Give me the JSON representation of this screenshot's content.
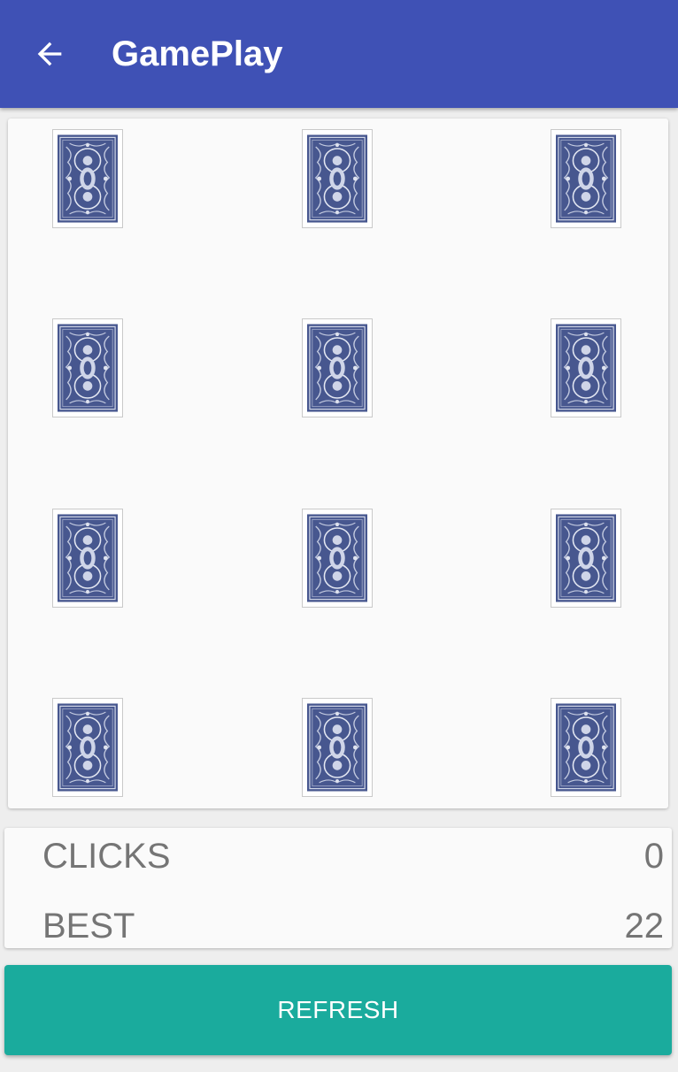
{
  "app_bar": {
    "title": "GamePlay",
    "back_icon": "arrow-back-icon",
    "background_color": "#3f51b5"
  },
  "board": {
    "columns": 3,
    "rows": 4,
    "card_back_color": "#47578f",
    "cards": [
      {
        "face": "card-back-icon"
      },
      {
        "face": "card-back-icon"
      },
      {
        "face": "card-back-icon"
      },
      {
        "face": "card-back-icon"
      },
      {
        "face": "card-back-icon"
      },
      {
        "face": "card-back-icon"
      },
      {
        "face": "card-back-icon"
      },
      {
        "face": "card-back-icon"
      },
      {
        "face": "card-back-icon"
      },
      {
        "face": "card-back-icon"
      },
      {
        "face": "card-back-icon"
      },
      {
        "face": "card-back-icon"
      }
    ]
  },
  "stats": {
    "clicks_label": "CLICKS",
    "clicks_value": "0",
    "best_label": "BEST",
    "best_value": "22"
  },
  "actions": {
    "refresh_label": "REFRESH",
    "refresh_color": "#1aab9d"
  }
}
